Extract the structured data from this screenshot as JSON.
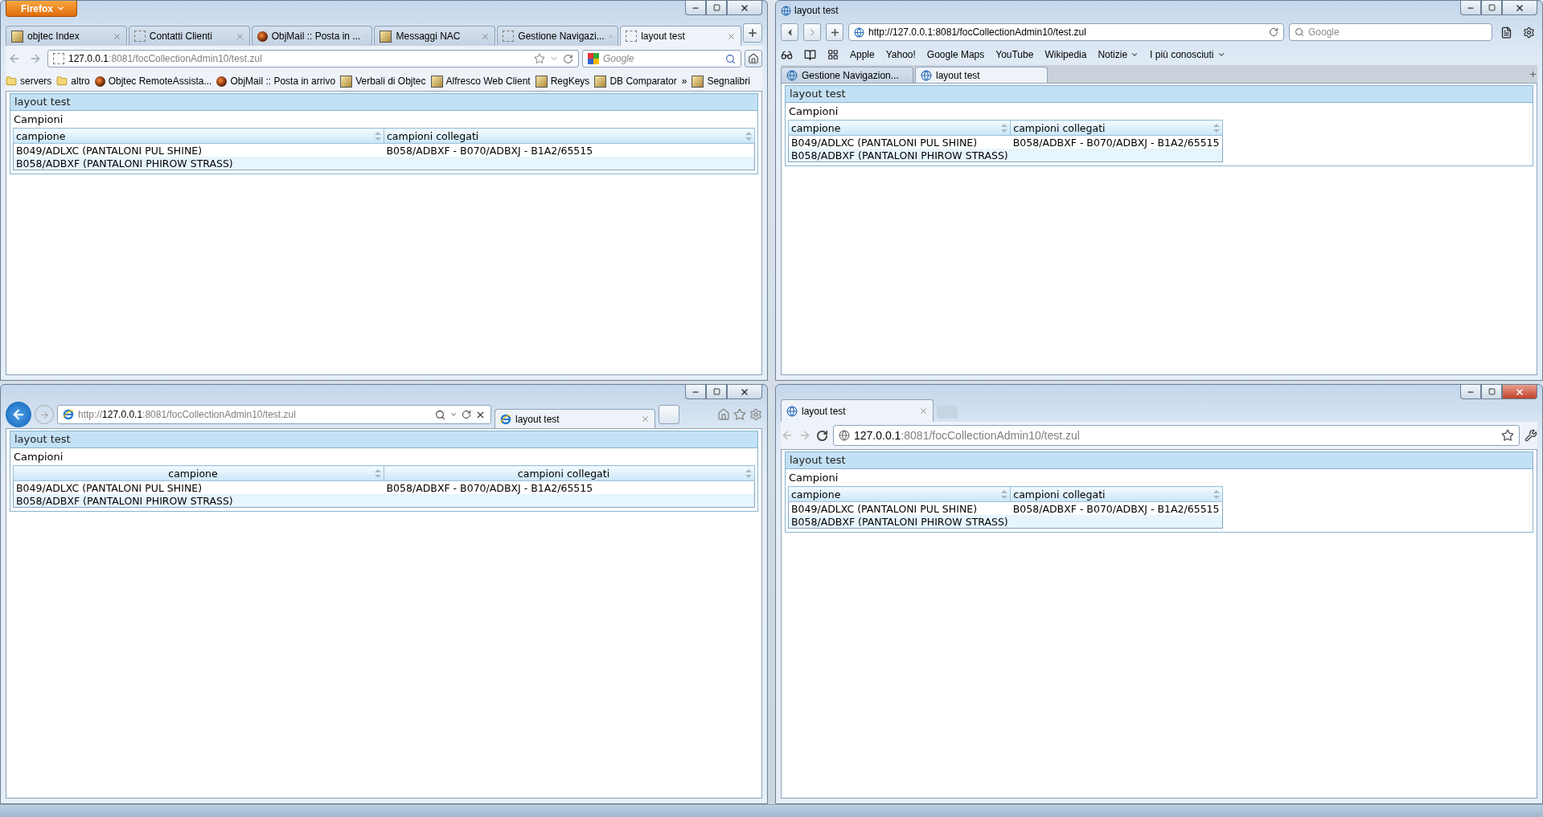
{
  "windows": [
    {
      "kind": "firefox",
      "active": false,
      "menu_button": "Firefox",
      "tabs": [
        {
          "label": "objtec Index",
          "selected": false
        },
        {
          "label": "Contatti Clienti",
          "selected": false
        },
        {
          "label": "ObjMail :: Posta in ...",
          "selected": false
        },
        {
          "label": "Messaggi NAC",
          "selected": false
        },
        {
          "label": "Gestione Navigazi...",
          "selected": false
        },
        {
          "label": "layout test",
          "selected": true
        }
      ],
      "url": [
        {
          "text": "127.0.0.1",
          "dim": false
        },
        {
          "text": ":8081/focCollectionAdmin10/test.zul",
          "dim": true
        }
      ],
      "search_placeholder": "Google",
      "bookmarks": [
        {
          "label": "servers"
        },
        {
          "label": "altro"
        },
        {
          "label": "Objtec RemoteAssista..."
        },
        {
          "label": "ObjMail :: Posta in arrivo"
        },
        {
          "label": "Verbali di Objtec"
        },
        {
          "label": "Alfresco Web Client"
        },
        {
          "label": "RegKeys"
        },
        {
          "label": "DB Comparator"
        }
      ],
      "bookmarks_overflow": "»",
      "bookmarks_menu": "Segnalibri",
      "page": {
        "title": "layout test",
        "section": "Campioni",
        "centered_headers": false,
        "fit": false,
        "columns": [
          "campione",
          "campioni collegati"
        ],
        "rows": [
          [
            "B049/ADLXC (PANTALONI PUL SHINE)",
            "B058/ADBXF - B070/ADBXJ - B1A2/65515"
          ],
          [
            "B058/ADBXF (PANTALONI PHIROW STRASS)"
          ]
        ]
      }
    },
    {
      "kind": "safari",
      "active": false,
      "title": "layout test",
      "url": [
        {
          "text": "http://127.0.0.1:8081/focCollectionAdmin10/test.zul",
          "dim": false
        }
      ],
      "search_placeholder": "Google",
      "bookmarks": [
        {
          "label": "Apple",
          "menu": false
        },
        {
          "label": "Yahoo!",
          "menu": false
        },
        {
          "label": "Google Maps",
          "menu": false
        },
        {
          "label": "YouTube",
          "menu": false
        },
        {
          "label": "Wikipedia",
          "menu": false
        },
        {
          "label": "Notizie",
          "menu": true
        },
        {
          "label": "I più conosciuti",
          "menu": true
        }
      ],
      "tabs": [
        {
          "label": "Gestione Navigazion...",
          "selected": false
        },
        {
          "label": "layout test",
          "selected": true
        }
      ],
      "page": {
        "title": "layout test",
        "section": "Campioni",
        "centered_headers": false,
        "fit": true,
        "columns": [
          "campione",
          "campioni collegati"
        ],
        "rows": [
          [
            "B049/ADLXC (PANTALONI PUL SHINE)",
            "B058/ADBXF - B070/ADBXJ - B1A2/65515"
          ],
          [
            "B058/ADBXF (PANTALONI PHIROW STRASS)"
          ]
        ]
      }
    },
    {
      "kind": "ie",
      "active": false,
      "url": [
        {
          "text": "http://",
          "dim": true
        },
        {
          "text": "127.0.0.1",
          "dim": false
        },
        {
          "text": ":8081/focCollectionAdmin10/test.zul",
          "dim": true
        }
      ],
      "tabs": [
        {
          "label": "layout test",
          "selected": true
        }
      ],
      "page": {
        "title": "layout test",
        "section": "Campioni",
        "centered_headers": true,
        "fit": false,
        "columns": [
          "campione",
          "campioni collegati"
        ],
        "rows": [
          [
            "B049/ADLXC (PANTALONI PUL SHINE)",
            "B058/ADBXF - B070/ADBXJ - B1A2/65515"
          ],
          [
            "B058/ADBXF (PANTALONI PHIROW STRASS)"
          ]
        ]
      }
    },
    {
      "kind": "chrome",
      "active": true,
      "tabs": [
        {
          "label": "layout test",
          "selected": true
        }
      ],
      "url": [
        {
          "text": "127.0.0.1",
          "dim": false
        },
        {
          "text": ":8081/focCollectionAdmin10/test.zul",
          "dim": true
        }
      ],
      "page": {
        "title": "layout test",
        "section": "Campioni",
        "centered_headers": false,
        "fit": true,
        "columns": [
          "campione",
          "campioni collegati"
        ],
        "rows": [
          [
            "B049/ADLXC (PANTALONI PUL SHINE)",
            "B058/ADBXF - B070/ADBXJ - B1A2/65515"
          ],
          [
            "B058/ADBXF (PANTALONI PHIROW STRASS)"
          ]
        ]
      }
    }
  ]
}
